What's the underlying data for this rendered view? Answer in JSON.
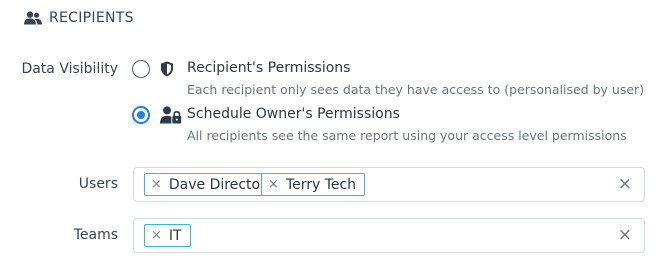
{
  "section": {
    "title": "RECIPIENTS",
    "icon": "people-icon"
  },
  "data_visibility": {
    "label": "Data Visibility",
    "options": [
      {
        "title": "Recipient's Permissions",
        "description": "Each recipient only sees data they have access to (personalised by user)",
        "icon": "shield-icon",
        "checked": false
      },
      {
        "title": "Schedule Owner's Permissions",
        "description": "All recipients see the same report using your access level permissions",
        "icon": "user-lock-icon",
        "checked": true
      }
    ]
  },
  "users": {
    "label": "Users",
    "tags": [
      "Dave Director",
      "Terry Tech"
    ],
    "tag_remove_glyph": "×",
    "clear_glyph": "×"
  },
  "teams": {
    "label": "Teams",
    "tags": [
      "IT"
    ],
    "tag_remove_glyph": "×",
    "clear_glyph": "×"
  },
  "colors": {
    "accent": "#1d7ff0",
    "tag_border": "#3fb6d4",
    "text": "#2c3645",
    "muted": "#6b7480"
  }
}
